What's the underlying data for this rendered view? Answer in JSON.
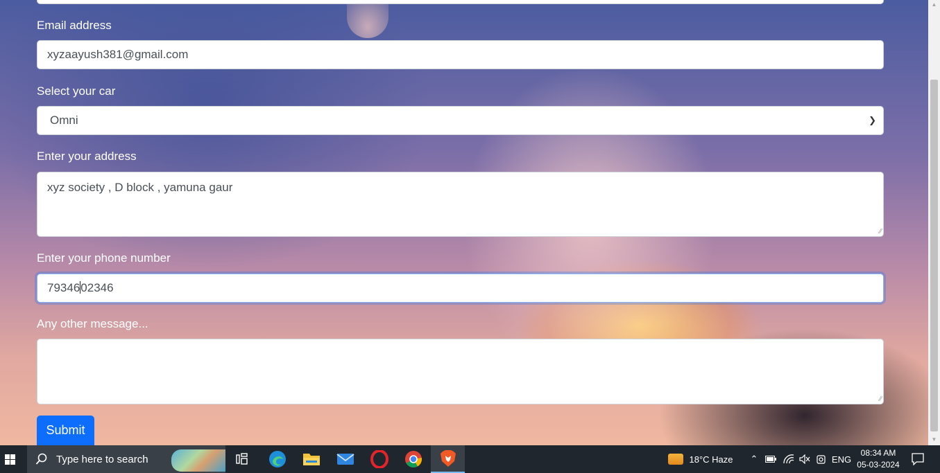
{
  "form": {
    "email_label": "Email address",
    "email_value": "xyzaayush381@gmail.com",
    "car_label": "Select your car",
    "car_selected": "Omni",
    "address_label": "Enter your address",
    "address_value": "xyz society , D block , yamuna gaur",
    "phone_label": "Enter your phone number",
    "phone_value_before_caret": "79346",
    "phone_value_after_caret": "02346",
    "message_label": "Any other message...",
    "message_value": "",
    "submit_label": "Submit"
  },
  "taskbar": {
    "search_placeholder": "Type here to search",
    "weather": "18°C  Haze",
    "language": "ENG",
    "time": "08:34 AM",
    "date": "05-03-2024",
    "apps": [
      "task-view",
      "edge",
      "file-explorer",
      "mail",
      "opera",
      "chrome",
      "brave"
    ]
  },
  "colors": {
    "submit_bg": "#0d6efd",
    "taskbar_bg": "#20262e",
    "focus_ring": "#86b7fe"
  }
}
